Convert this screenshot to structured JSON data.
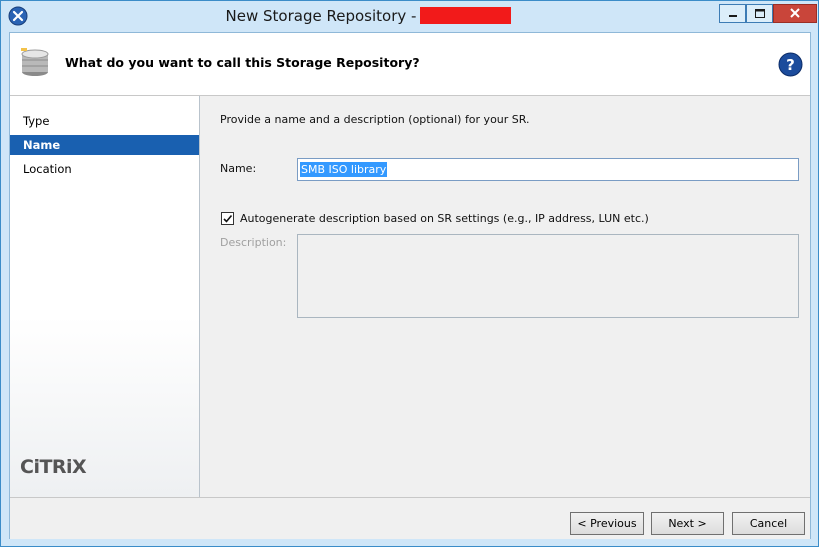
{
  "window": {
    "title": "New Storage Repository -",
    "redacted_color": "#f21a1a"
  },
  "header": {
    "title": "What do you want to call this Storage Repository?"
  },
  "nav": {
    "items": [
      {
        "label": "Type",
        "selected": false
      },
      {
        "label": "Name",
        "selected": true
      },
      {
        "label": "Location",
        "selected": false
      }
    ],
    "logo": "CiTRiX"
  },
  "content": {
    "intro": "Provide a name and a description (optional) for your SR.",
    "name_label": "Name:",
    "name_value": "SMB ISO library",
    "autogen_checked": true,
    "autogen_label": "Autogenerate description based on SR settings (e.g., IP address, LUN etc.)",
    "description_label": "Description:",
    "description_value": ""
  },
  "footer": {
    "previous_label": "< Previous",
    "next_label": "Next >",
    "cancel_label": "Cancel"
  },
  "colors": {
    "selection": "#1960b0",
    "text_highlight": "#3399ff"
  }
}
